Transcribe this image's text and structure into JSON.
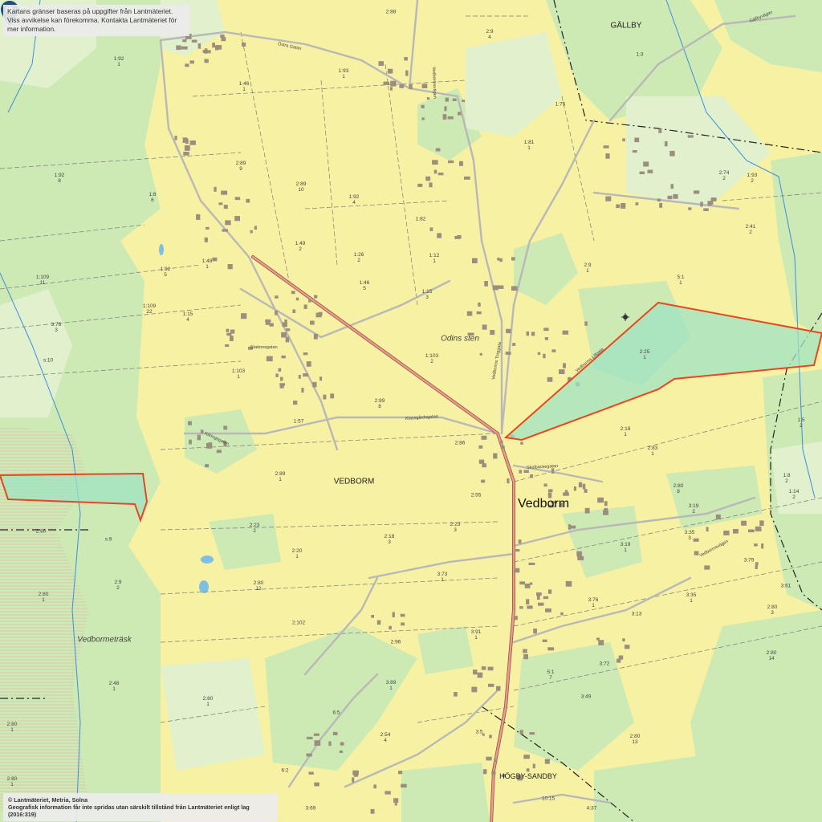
{
  "map": {
    "notice_line1": "Kartans gränser baseras på uppgifter från Lantmäteriet.",
    "notice_line2": "Viss avvikelse kan förekomma. Kontakta Lantmäteriet för mer information.",
    "copyright_line1": "© Lantmäteriet, Metria, Solna",
    "copyright_line2": "Geografisk information får inte spridas utan särskilt tillstånd från Lantmäteriet enligt lag (2016:319)",
    "colors": {
      "field": "#f7f1a3",
      "forest": "#cde9b4",
      "lightforest": "#e2f1cd",
      "highlight_fill": "#9fe3c3",
      "highlight_stroke": "#e8461e",
      "main_road": "#d87f72",
      "marker": "#1f4e86"
    },
    "places": {
      "town": "Vedborm",
      "village": "VEDBORM",
      "gallby": "GÄLLBY",
      "hogby": "HÖGBY-SANDBY",
      "odins_sten": "Odins sten",
      "lake": "Vedbormeträsk"
    },
    "streets": {
      "station": "Stationsgatan",
      "klassgarde": "Klassgårdsgatan",
      "skolbacke": "Skolbackegatan",
      "vedborm_torg": "Vedborms Torggata",
      "vedborm_lilla": "Vedborms Lillgata",
      "ringstigen": "Vedbormsvägen",
      "gallbyvagen": "Gällbyvägen",
      "ostra": "Östra Gatan",
      "karingen": "Käringegatan",
      "landsv": "Vedbormsvägen"
    },
    "parcels": [
      {
        "id": "1:92\n1"
      },
      {
        "id": "1:93\n1"
      },
      {
        "id": "1:46\n1"
      },
      {
        "id": "2:88"
      },
      {
        "id": "2:9\n4"
      },
      {
        "id": "1:75"
      },
      {
        "id": "1:81\n1"
      },
      {
        "id": "1:3"
      },
      {
        "id": "1:92\n8"
      },
      {
        "id": "1:8\n6"
      },
      {
        "id": "2:89\n9"
      },
      {
        "id": "2:89\n10"
      },
      {
        "id": "1:92\n4"
      },
      {
        "id": "1:49\n2"
      },
      {
        "id": "1:26\n2"
      },
      {
        "id": "1:82"
      },
      {
        "id": "1:12\n1"
      },
      {
        "id": "1:48\n1"
      },
      {
        "id": "1:92\n5"
      },
      {
        "id": "1:109\n11"
      },
      {
        "id": "1:46\n5"
      },
      {
        "id": "1:15\n3"
      },
      {
        "id": "1:109\n22"
      },
      {
        "id": "1:15\n4"
      },
      {
        "id": "3:76\n3"
      },
      {
        "id": "s:10"
      },
      {
        "id": "1:103\n1"
      },
      {
        "id": "1:103\n2"
      },
      {
        "id": "2:89\n8"
      },
      {
        "id": "1:57"
      },
      {
        "id": "2:86"
      },
      {
        "id": "2:9\n1"
      },
      {
        "id": "5:1\n1"
      },
      {
        "id": "2:25\n1"
      },
      {
        "id": "2:18\n1"
      },
      {
        "id": "2:83\n1"
      },
      {
        "id": "2:80\n8"
      },
      {
        "id": "2:89\n1"
      },
      {
        "id": "2:23\n2"
      },
      {
        "id": "2:18\n3"
      },
      {
        "id": "2:23\n3"
      },
      {
        "id": "2:20\n1"
      },
      {
        "id": "2:80\n12"
      },
      {
        "id": "3:73\n1"
      },
      {
        "id": "3:19\n2"
      },
      {
        "id": "3:19\n1"
      },
      {
        "id": "3:35\n1"
      },
      {
        "id": "3:76\n1"
      },
      {
        "id": "3:13"
      },
      {
        "id": "3:79"
      },
      {
        "id": "3:61"
      },
      {
        "id": "2:80\n3"
      },
      {
        "id": "2:102"
      },
      {
        "id": "2:96"
      },
      {
        "id": "3:91\n1"
      },
      {
        "id": "5:1\n7"
      },
      {
        "id": "3:72"
      },
      {
        "id": "3:49"
      },
      {
        "id": "2:80\n14"
      },
      {
        "id": "2:80\n1"
      },
      {
        "id": "2:9\n2"
      },
      {
        "id": "2:48\n1"
      },
      {
        "id": "s:9"
      },
      {
        "id": "2:80"
      },
      {
        "id": "2:80\n1"
      },
      {
        "id": "3:89\n1"
      },
      {
        "id": "2:54\n4"
      },
      {
        "id": "3:5"
      },
      {
        "id": "2:80\n13"
      },
      {
        "id": "10:15"
      },
      {
        "id": "4:37"
      },
      {
        "id": "3:69"
      },
      {
        "id": "6:2"
      },
      {
        "id": "1:93\n2"
      },
      {
        "id": "2:41\n2"
      },
      {
        "id": "2:74\n2"
      },
      {
        "id": "1:5\n2"
      },
      {
        "id": "1:8\n2"
      },
      {
        "id": "1:14\n2"
      },
      {
        "id": "3:35\n3"
      },
      {
        "id": "2:55"
      },
      {
        "id": "2:80\n1"
      },
      {
        "id": "6:5"
      },
      {
        "id": "2:80\n1"
      }
    ]
  }
}
